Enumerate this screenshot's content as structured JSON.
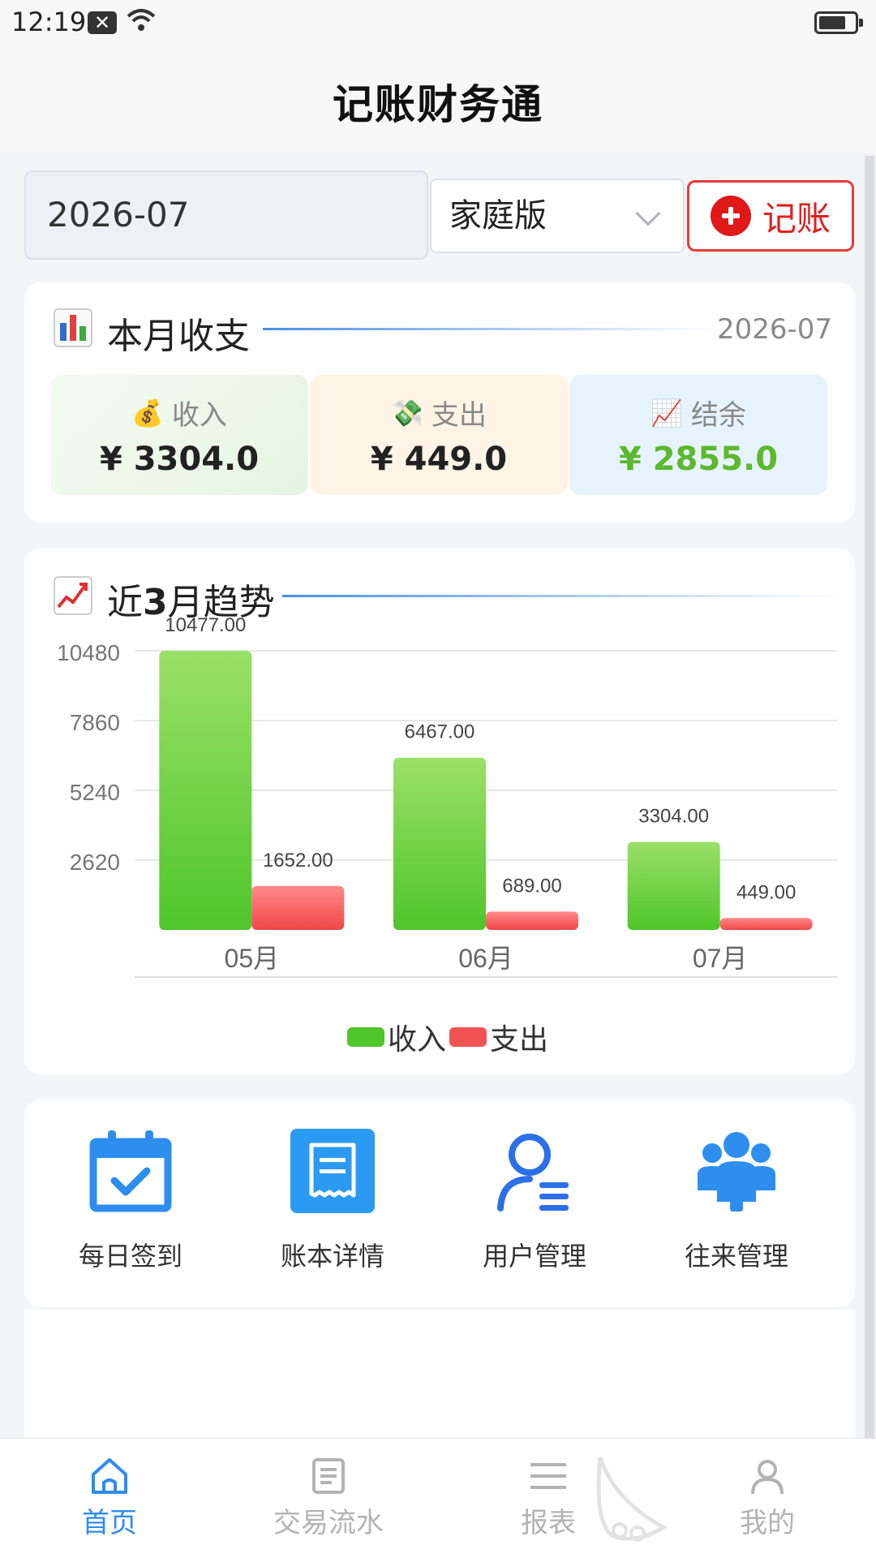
{
  "status_bar": {
    "time": "12:19",
    "notification_icon": "close-box-icon"
  },
  "app": {
    "title": "记账财务通"
  },
  "controls": {
    "month": "2026-07",
    "book_type": "家庭版",
    "add_label": "记账"
  },
  "summary": {
    "title": "本月收支",
    "date": "2026-07",
    "income": {
      "label": "收入",
      "value": "¥ 3304.0",
      "icon": "money-bag-icon"
    },
    "expense": {
      "label": "支出",
      "value": "¥ 449.0",
      "icon": "flying-money-icon"
    },
    "balance": {
      "label": "结余",
      "value": "¥ 2855.0",
      "icon": "chart-up-icon"
    }
  },
  "trend": {
    "title_prefix": "近",
    "title_num": "3",
    "title_suffix": "月趋势"
  },
  "chart_data": {
    "type": "bar",
    "categories": [
      "05月",
      "06月",
      "07月"
    ],
    "series": [
      {
        "name": "收入",
        "values": [
          10477.0,
          6467.0,
          3304.0
        ],
        "color": "#4ec62a"
      },
      {
        "name": "支出",
        "values": [
          1652.0,
          689.0,
          449.0
        ],
        "color": "#f25454"
      }
    ],
    "data_labels": [
      [
        "10477.00",
        "6467.00",
        "3304.00"
      ],
      [
        "1652.00",
        "689.00",
        "449.00"
      ]
    ],
    "y_ticks": [
      "2620",
      "5240",
      "7860",
      "10480"
    ],
    "ylim": [
      0,
      10480
    ],
    "legend": "bottom",
    "grid": true
  },
  "menu": [
    {
      "label": "每日签到",
      "icon": "calendar-check-icon"
    },
    {
      "label": "账本详情",
      "icon": "receipt-icon"
    },
    {
      "label": "用户管理",
      "icon": "user-manage-icon"
    },
    {
      "label": "往来管理",
      "icon": "group-icon"
    }
  ],
  "nav": [
    {
      "label": "首页",
      "icon": "home-icon",
      "active": true
    },
    {
      "label": "交易流水",
      "icon": "document-icon",
      "active": false
    },
    {
      "label": "报表",
      "icon": "list-icon",
      "active": false
    },
    {
      "label": "我的",
      "icon": "profile-icon",
      "active": false
    }
  ],
  "colors": {
    "accent": "#2c8cf4",
    "income": "#4ec62a",
    "expense": "#f25454",
    "balance": "#5cb82e",
    "danger": "#e01818"
  }
}
